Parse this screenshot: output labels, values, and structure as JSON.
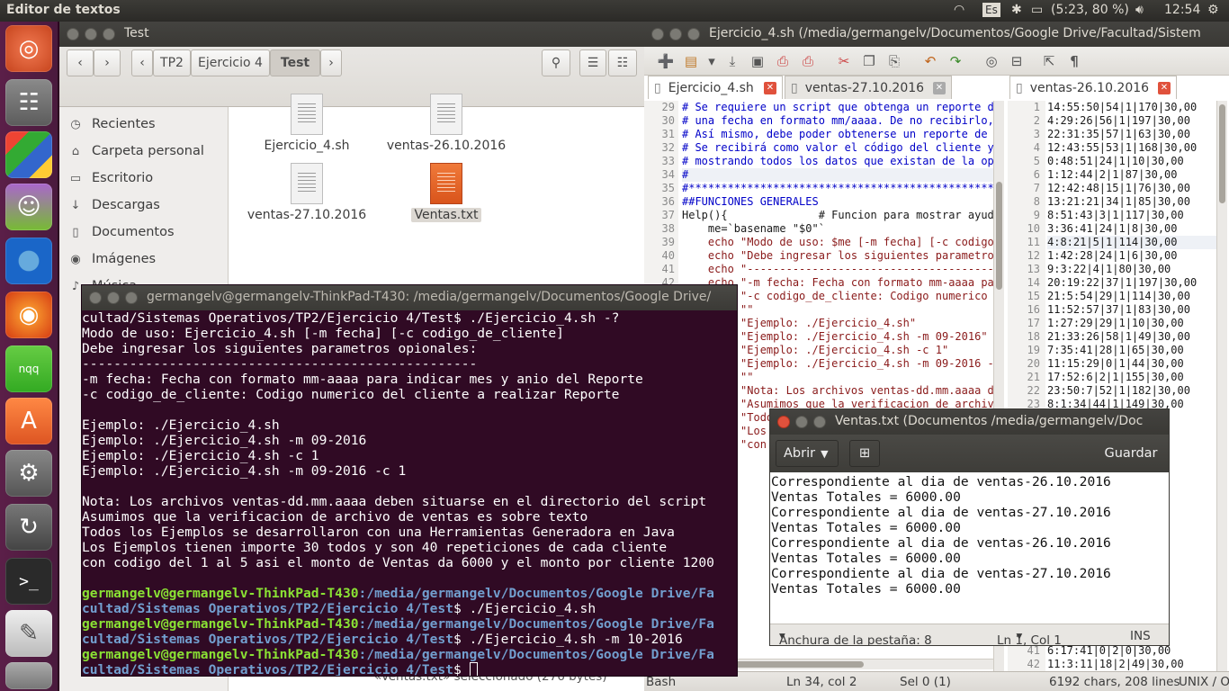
{
  "topbar": {
    "app_title": "Editor de textos",
    "keyboard": "Es",
    "battery": "(5:23, 80 %)",
    "clock": "12:54"
  },
  "launcher": {
    "icons": [
      "ubuntu-dash-icon",
      "files-icon",
      "libreoffice-icon",
      "pidgin-icon",
      "chromium-icon",
      "firefox-icon",
      "nqq-icon",
      "software-center-icon",
      "settings-icon",
      "update-manager-icon",
      "terminal-icon",
      "gedit-icon",
      "drive-icon"
    ]
  },
  "nautilus": {
    "title": "Test",
    "crumbs": [
      "TP2",
      "Ejercicio 4",
      "Test"
    ],
    "sidebar": [
      "Recientes",
      "Carpeta personal",
      "Escritorio",
      "Descargas",
      "Documentos",
      "Imágenes",
      "Música"
    ],
    "files": [
      "Ejercicio_4.sh",
      "ventas-26.10.2016",
      "ventas-27.10.2016",
      "Ventas.txt"
    ],
    "status": "«Ventas.txt» seleccionado  (276 bytes)"
  },
  "gedit": {
    "title": "Ejercicio_4.sh (/media/germangelv/Documentos/Google Drive/Facultad/Sistem",
    "tabs": [
      "Ejercicio_4.sh",
      "ventas-27.10.2016",
      "ventas-26.10.2016"
    ],
    "left_lines": [
      {
        "n": "29",
        "t": "# Se requiere un script que obtenga un reporte d"
      },
      {
        "n": "30",
        "t": "# una fecha en formato mm/aaaa. De no recibirlo,"
      },
      {
        "n": "31",
        "t": "# Así mismo, debe poder obtenerse un reporte de "
      },
      {
        "n": "32",
        "t": "# Se recibirá como valor el código del cliente y"
      },
      {
        "n": "33",
        "t": "# mostrando todos los datos que existan de la op"
      },
      {
        "n": "34",
        "t": "#"
      },
      {
        "n": "35",
        "t": "#***********************************************"
      },
      {
        "n": "36",
        "t": "##FUNCIONES GENERALES"
      },
      {
        "n": "37",
        "t": "Help(){              # Funcion para mostrar ayuda"
      },
      {
        "n": "38",
        "t": "    me=`basename \"$0\"`"
      },
      {
        "n": "39",
        "t": "    echo \"Modo de uso: $me [-m fecha] [-c codigo"
      },
      {
        "n": "40",
        "t": "    echo \"Debe ingresar los siguientes parametro"
      },
      {
        "n": "41",
        "t": "    echo \"----------------------------------------"
      },
      {
        "n": "42",
        "t": "    echo \"-m fecha: Fecha con formato mm-aaaa pa"
      },
      {
        "n": "43",
        "t": "    echo \"-c codigo_de_cliente: Codigo numerico "
      },
      {
        "n": "44",
        "t": "    echo \"\""
      },
      {
        "n": "45",
        "t": "    echo \"Ejemplo: ./Ejercicio_4.sh\""
      },
      {
        "n": "46",
        "t": "    echo \"Ejemplo: ./Ejercicio_4.sh -m 09-2016\""
      },
      {
        "n": "47",
        "t": "    echo \"Ejemplo: ./Ejercicio_4.sh -c 1\""
      },
      {
        "n": "48",
        "t": "    echo \"Ejemplo: ./Ejercicio_4.sh -m 09-2016 -"
      },
      {
        "n": "49",
        "t": "    echo \"\""
      },
      {
        "n": "50",
        "t": "    echo \"Nota: Los archivos ventas-dd.mm.aaaa d"
      },
      {
        "n": "51",
        "t": "    echo \"Asumimos que la verificacion de archiv"
      },
      {
        "n": "52",
        "t": "    echo \"Todos los Ejemplos se desarrollaron co"
      },
      {
        "n": "53",
        "t": "    echo \"Los Ejemplos tienen importe 30 todos y"
      },
      {
        "n": "54",
        "t": "    echo \"con codigo del 1 al 5 asi el monto de "
      }
    ],
    "right_lines": [
      {
        "n": "1",
        "t": "14:55:50|54|1|170|30,00"
      },
      {
        "n": "2",
        "t": "4:29:26|56|1|197|30,00"
      },
      {
        "n": "3",
        "t": "22:31:35|57|1|63|30,00"
      },
      {
        "n": "4",
        "t": "12:43:55|53|1|168|30,00"
      },
      {
        "n": "5",
        "t": "0:48:51|24|1|10|30,00"
      },
      {
        "n": "6",
        "t": "1:12:44|2|1|87|30,00"
      },
      {
        "n": "7",
        "t": "12:42:48|15|1|76|30,00"
      },
      {
        "n": "8",
        "t": "13:21:21|34|1|85|30,00"
      },
      {
        "n": "9",
        "t": "8:51:43|3|1|117|30,00"
      },
      {
        "n": "10",
        "t": "3:36:41|24|1|8|30,00"
      },
      {
        "n": "11",
        "t": "4:8:21|5|1|114|30,00"
      },
      {
        "n": "12",
        "t": "1:42:28|24|1|6|30,00"
      },
      {
        "n": "13",
        "t": "9:3:22|4|1|80|30,00"
      },
      {
        "n": "14",
        "t": "20:19:22|37|1|197|30,00"
      },
      {
        "n": "15",
        "t": "21:5:54|29|1|114|30,00"
      },
      {
        "n": "16",
        "t": "11:52:57|37|1|83|30,00"
      },
      {
        "n": "17",
        "t": "1:27:29|29|1|10|30,00"
      },
      {
        "n": "18",
        "t": "21:33:26|58|1|49|30,00"
      },
      {
        "n": "19",
        "t": "7:35:41|28|1|65|30,00"
      },
      {
        "n": "20",
        "t": "11:15:29|0|1|44|30,00"
      },
      {
        "n": "21",
        "t": "17:52:6|2|1|155|30,00"
      },
      {
        "n": "22",
        "t": "23:50:7|52|1|182|30,00"
      },
      {
        "n": "23",
        "t": "8:1:34|44|1|149|30,00"
      }
    ],
    "right_tail": [
      {
        "n": "41",
        "t": "6:17:41|0|2|0|30,00"
      },
      {
        "n": "42",
        "t": "11:3:11|18|2|49|30,00"
      }
    ],
    "status": {
      "lang": "Bash",
      "pos": "Ln 34, col 2",
      "sel": "Sel 0 (1)",
      "count": "6192 chars, 208 lines",
      "eol": "UNIX / O"
    }
  },
  "terminal": {
    "title": "germangelv@germangelv-ThinkPad-T430: /media/germangelv/Documentos/Google Drive/",
    "out_lines": [
      "cultad/Sistemas Operativos/TP2/Ejercicio 4/Test$ ./Ejercicio_4.sh -?",
      "Modo de uso: Ejercicio_4.sh [-m fecha] [-c codigo_de_cliente]",
      "Debe ingresar los siguientes parametros opionales:",
      "--------------------------------------------------",
      "-m fecha: Fecha con formato mm-aaaa para indicar mes y anio del Reporte",
      "-c codigo_de_cliente: Codigo numerico del cliente a realizar Reporte",
      "",
      "Ejemplo: ./Ejercicio_4.sh",
      "Ejemplo: ./Ejercicio_4.sh -m 09-2016",
      "Ejemplo: ./Ejercicio_4.sh -c 1",
      "Ejemplo: ./Ejercicio_4.sh -m 09-2016 -c 1",
      "",
      "Nota: Los archivos ventas-dd.mm.aaaa deben situarse en el directorio del script",
      "Asumimos que la verificacion de archivo de ventas es sobre texto",
      "Todos los Ejemplos se desarrollaron con una Herramientas Generadora en Java",
      "Los Ejemplos tienen importe 30 todos y son 40 repeticiones de cada cliente",
      "con codigo del 1 al 5 asi el monto de Ventas da 6000 y el monto por cliente 1200",
      ""
    ],
    "user": "germangelv@germangelv-ThinkPad-T430",
    "path1": ":/media/germangelv/Documentos/Google Drive/Fa",
    "path2": "cultad/Sistemas Operativos/TP2/Ejercicio 4/Test",
    "cmd1": "$ ./Ejercicio_4.sh",
    "cmd2": "$ ./Ejercicio_4.sh -m 10-2016",
    "cmd3": "$ "
  },
  "ventas_txt": {
    "title": "Ventas.txt (Documentos /media/germangelv/Doc",
    "open_label": "Abrir",
    "save_label": "Guardar",
    "lines": [
      "Correspondiente al dia de ventas-26.10.2016",
      "Ventas Totales = 6000.00",
      "Correspondiente al dia de ventas-27.10.2016",
      "Ventas Totales = 6000.00",
      "Correspondiente al dia de ventas-26.10.2016",
      "Ventas Totales = 6000.00",
      "Correspondiente al dia de ventas-27.10.2016",
      "Ventas Totales = 6000.00"
    ],
    "tab_width": "Anchura de la pestaña: 8",
    "pos": "Ln 1, Col 1",
    "ins": "INS"
  }
}
